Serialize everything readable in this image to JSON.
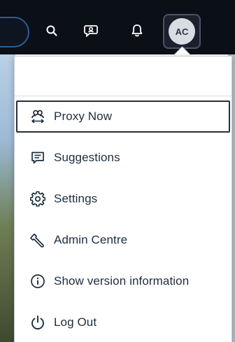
{
  "shellbar": {
    "background_color": "#0b0f16",
    "search_icon": "search-icon",
    "feedback_icon": "feedback-icon",
    "notifications_icon": "bell-icon",
    "avatar_initials": "AC"
  },
  "popover": {
    "menu": [
      {
        "label": "Proxy Now",
        "icon": "proxy-icon",
        "focused": true
      },
      {
        "label": "Suggestions",
        "icon": "suggestions-icon",
        "focused": false
      },
      {
        "label": "Settings",
        "icon": "gear-icon",
        "focused": false
      },
      {
        "label": "Admin Centre",
        "icon": "wrench-icon",
        "focused": false
      },
      {
        "label": "Show version information",
        "icon": "info-icon",
        "focused": false
      },
      {
        "label": "Log Out",
        "icon": "power-icon",
        "focused": false
      }
    ]
  },
  "colors": {
    "text": "#1d2d3e",
    "focus_border": "#2a2f35",
    "divider": "#d5dadf"
  }
}
